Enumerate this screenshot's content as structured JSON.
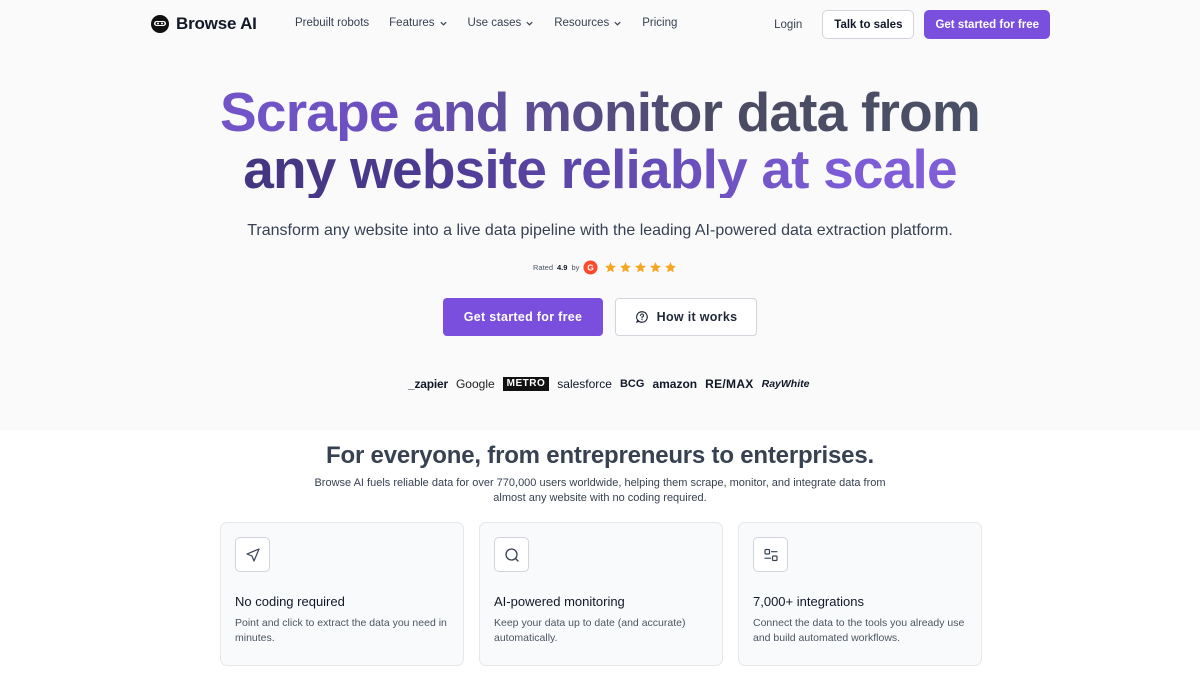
{
  "brand": {
    "name": "Browse AI"
  },
  "nav": {
    "links": [
      {
        "label": "Prebuilt robots",
        "dropdown": false
      },
      {
        "label": "Features",
        "dropdown": true
      },
      {
        "label": "Use cases",
        "dropdown": true
      },
      {
        "label": "Resources",
        "dropdown": true
      },
      {
        "label": "Pricing",
        "dropdown": false
      }
    ],
    "login": "Login",
    "talk_to_sales": "Talk to sales",
    "get_started": "Get started for free"
  },
  "hero": {
    "title_line1": "Scrape and monitor data from",
    "title_line2": "any website reliably at scale",
    "subtitle": "Transform any website into a live data pipeline with the leading AI-powered data extraction platform.",
    "rating_prefix": "Rated",
    "rating_value": "4.9",
    "rating_suffix": "by",
    "stars": 5,
    "cta_primary": "Get started for free",
    "cta_secondary": "How it works"
  },
  "customer_logos": [
    "_zapier",
    "Google",
    "METRO",
    "salesforce",
    "BCG",
    "amazon",
    "RE/MAX",
    "RayWhite"
  ],
  "section": {
    "title": "For everyone, from entrepreneurs to enterprises.",
    "subtitle": "Browse AI fuels reliable data for over 770,000 users worldwide, helping them scrape, monitor, and integrate data from almost any website with no coding required.",
    "cards": [
      {
        "icon": "cursor-arrow-icon",
        "title": "No coding required",
        "text": "Point and click to extract the data you need in minutes."
      },
      {
        "icon": "magnifier-icon",
        "title": "AI-powered monitoring",
        "text": "Keep your data up to date (and accurate) automatically."
      },
      {
        "icon": "integrations-icon",
        "title": "7,000+ integrations",
        "text": "Connect the data to the tools you already use and build automated workflows."
      }
    ]
  },
  "colors": {
    "accent": "#7a4fdd",
    "star": "#f5a623"
  }
}
